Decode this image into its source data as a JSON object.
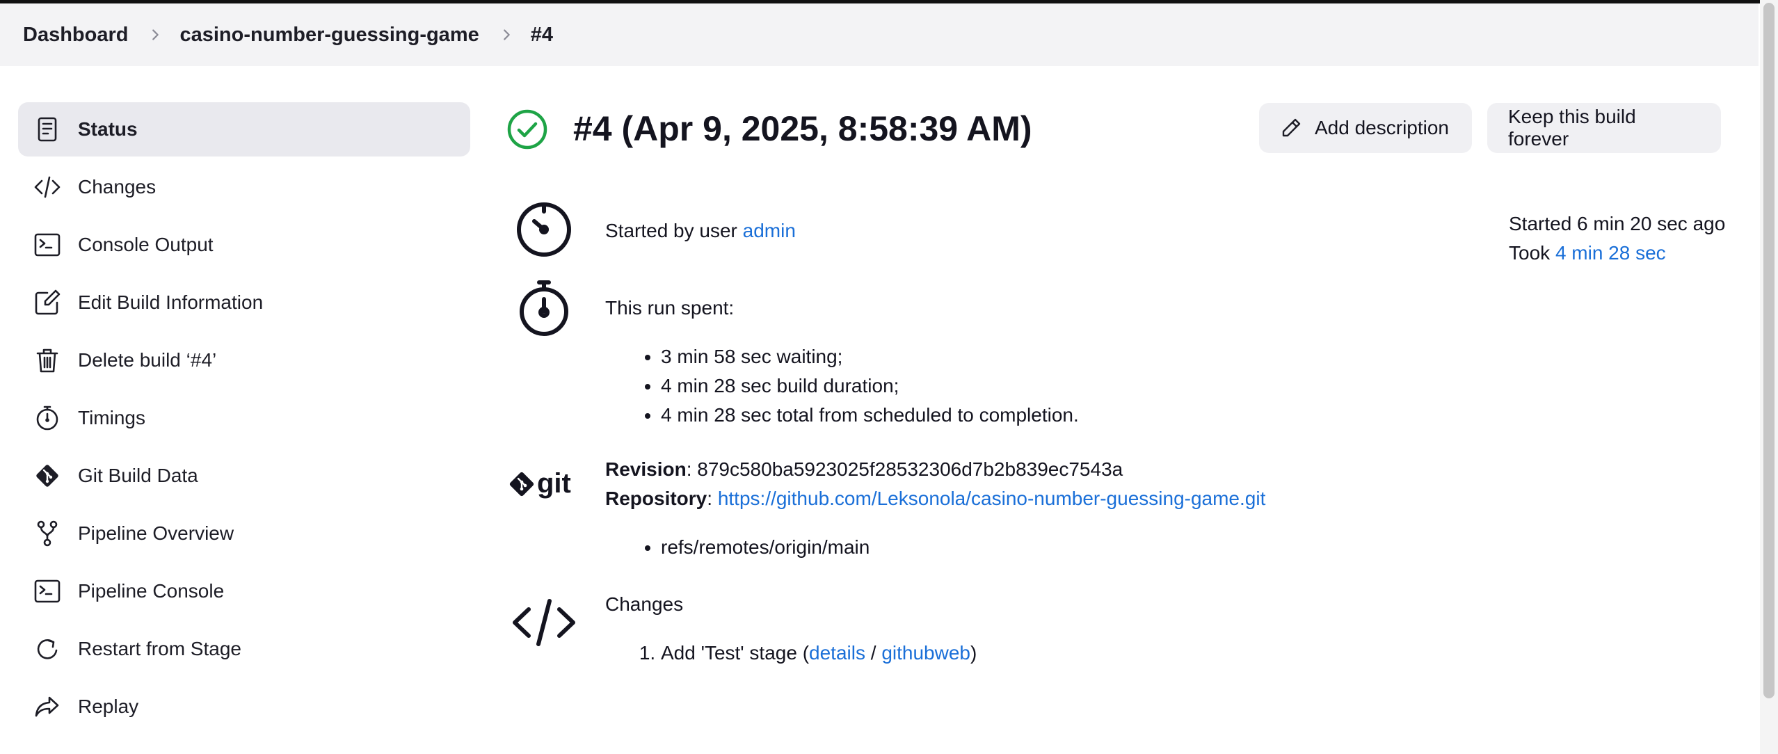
{
  "breadcrumb": {
    "items": [
      "Dashboard",
      "casino-number-guessing-game",
      "#4"
    ]
  },
  "sidebar": {
    "items": [
      {
        "label": "Status",
        "icon": "document-icon",
        "active": true
      },
      {
        "label": "Changes",
        "icon": "code-icon"
      },
      {
        "label": "Console Output",
        "icon": "terminal-icon"
      },
      {
        "label": "Edit Build Information",
        "icon": "edit-icon"
      },
      {
        "label": "Delete build ‘#4’",
        "icon": "trash-icon"
      },
      {
        "label": "Timings",
        "icon": "stopwatch-icon"
      },
      {
        "label": "Git Build Data",
        "icon": "git-icon"
      },
      {
        "label": "Pipeline Overview",
        "icon": "branch-icon"
      },
      {
        "label": "Pipeline Console",
        "icon": "terminal-icon"
      },
      {
        "label": "Restart from Stage",
        "icon": "restart-icon"
      },
      {
        "label": "Replay",
        "icon": "replay-icon"
      }
    ]
  },
  "build": {
    "title": "#4 (Apr 9, 2025, 8:58:39 AM)",
    "status": "success",
    "add_description_label": "Add description",
    "keep_forever_label": "Keep this build forever"
  },
  "started": {
    "prefix": "Started by user ",
    "user": "admin",
    "started_ago": "Started 6 min 20 sec ago",
    "took_prefix": "Took ",
    "took": "4 min 28 sec"
  },
  "run": {
    "heading": "This run spent:",
    "items": [
      "3 min 58 sec waiting;",
      "4 min 28 sec build duration;",
      "4 min 28 sec total from scheduled to completion."
    ]
  },
  "git": {
    "logo_text": "git",
    "revision_label": "Revision",
    "revision": "879c580ba5923025f28532306d7b2b839ec7543a",
    "repository_label": "Repository",
    "repository": "https://github.com/Leksonola/casino-number-guessing-game.git",
    "refs": [
      "refs/remotes/origin/main"
    ]
  },
  "changes": {
    "heading": "Changes",
    "items": [
      {
        "text": "Add 'Test' stage (",
        "details": "details",
        "sep": " / ",
        "githubweb": "githubweb",
        "close": ")"
      }
    ]
  },
  "colors": {
    "success": "#1ea446",
    "link": "#1a6fd8",
    "active_bg": "#e9e9ee",
    "breadcrumb_bg": "#f3f3f5"
  }
}
